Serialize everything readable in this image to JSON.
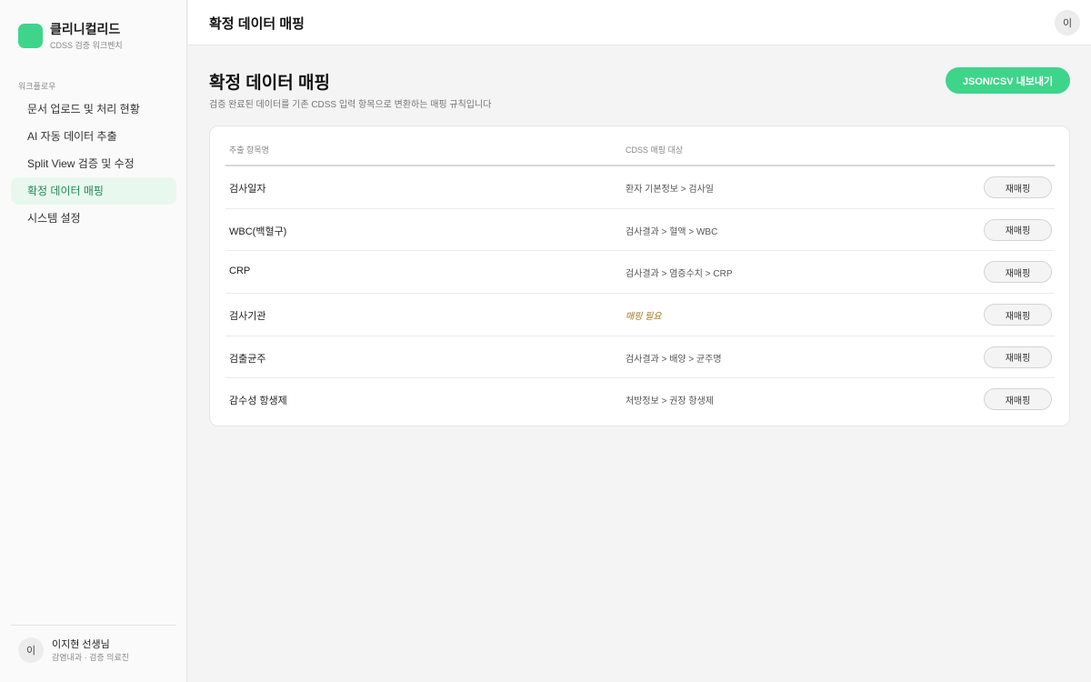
{
  "brand": {
    "name": "클리니컬리드",
    "subtitle": "CDSS 검증 워크벤치",
    "logo_color": "#3ed58a"
  },
  "sidebar": {
    "section_label": "워크플로우",
    "items": [
      {
        "label": "문서 업로드 및 처리 현황",
        "active": false
      },
      {
        "label": "AI 자동 데이터 추출",
        "active": false
      },
      {
        "label": "Split View 검증 및 수정",
        "active": false
      },
      {
        "label": "확정 데이터 매핑",
        "active": true
      },
      {
        "label": "시스템 설정",
        "active": false
      }
    ],
    "user": {
      "avatar": "이",
      "name": "이지현 선생님",
      "role": "감염내과 · 검증 의료진"
    }
  },
  "topbar": {
    "title": "확정 데이터 매핑",
    "avatar": "이"
  },
  "main": {
    "title": "확정 데이터 매핑",
    "description": "검증 완료된 데이터를 기존 CDSS 입력 항목으로 변환하는 매핑 규칙입니다",
    "export_label": "JSON/CSV 내보내기",
    "table": {
      "headers": [
        "추출 항목명",
        "CDSS 매핑 대상"
      ],
      "rows": [
        {
          "name": "검사일자",
          "target": "환자 기본정보 > 검사일",
          "action": "재매핑"
        },
        {
          "name": "WBC(백혈구)",
          "target": "검사결과 > 혈액 > WBC",
          "action": "재매핑"
        },
        {
          "name": "CRP",
          "target": "검사결과 > 염증수치 > CRP",
          "action": "재매핑"
        },
        {
          "name": "검사기관",
          "target": "매핑 필요",
          "action": "재매핑"
        },
        {
          "name": "검출균주",
          "target": "검사결과 > 배양 > 균주명",
          "action": "재매핑"
        },
        {
          "name": "감수성 항생제",
          "target": "처방정보 > 권장 항생제",
          "action": "재매핑"
        }
      ]
    }
  },
  "colors": {
    "accent": "#3ed58a",
    "active_nav_bg": "#e8f8ee",
    "active_nav_text": "#238a55",
    "warning_text": "#a07a1c"
  }
}
